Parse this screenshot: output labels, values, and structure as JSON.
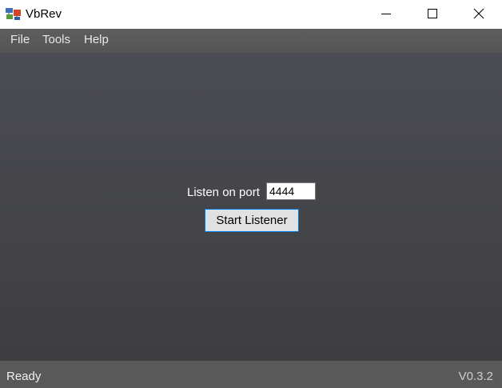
{
  "window": {
    "title": "VbRev",
    "app_icon": "vbrev-app-icon",
    "controls": {
      "minimize_icon": "minimize-icon",
      "maximize_icon": "maximize-icon",
      "close_icon": "close-icon"
    }
  },
  "menu": {
    "items": [
      {
        "label": "File"
      },
      {
        "label": "Tools"
      },
      {
        "label": "Help"
      }
    ]
  },
  "listener": {
    "port_label": "Listen on port",
    "port_value": "4444",
    "start_label": "Start Listener"
  },
  "status": {
    "text": "Ready",
    "version": "V0.3.2"
  },
  "colors": {
    "menubar": "#5a5a5a",
    "main_background_top": "#4b4c53",
    "main_background_bottom": "#3e3e40",
    "statusbar": "#595959",
    "button_focus_border": "#0078d7"
  }
}
